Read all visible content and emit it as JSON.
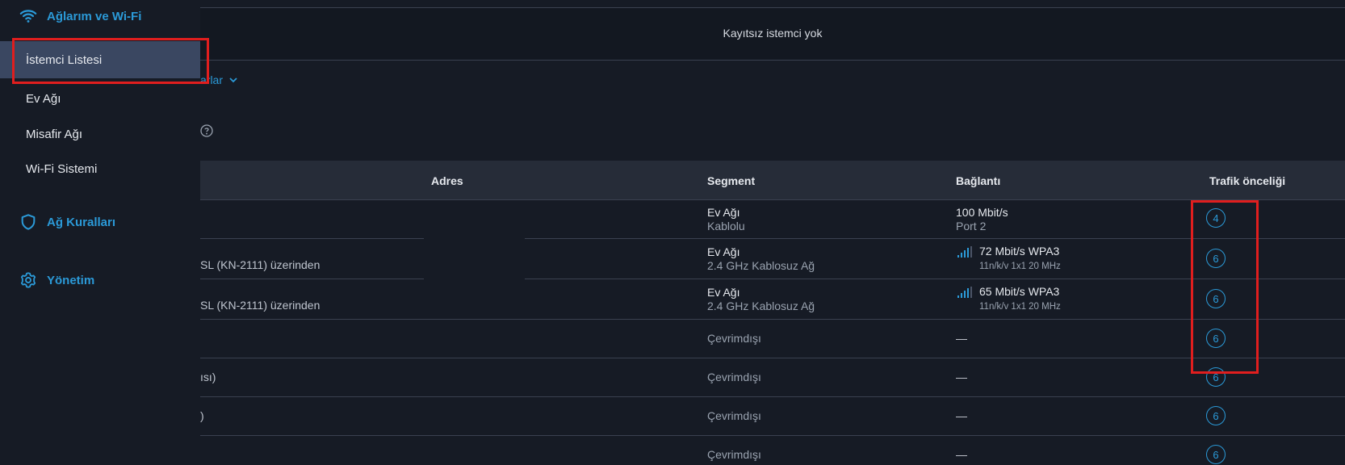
{
  "sidebar": {
    "networks_title": "Ağlarım ve Wi-Fi",
    "items": [
      {
        "label": "İstemci Listesi"
      },
      {
        "label": "Ev Ağı"
      },
      {
        "label": "Misafir Ağı"
      },
      {
        "label": "Wi-Fi Sistemi"
      }
    ],
    "rules_title": "Ağ Kuralları",
    "admin_title": "Yönetim"
  },
  "main": {
    "unregistered_text": "Kayıtsız istemci yok",
    "filter_link_partial": "arlar",
    "table": {
      "headers": {
        "address": "Adres",
        "segment": "Segment",
        "connection": "Bağlantı",
        "priority": "Trafik önceliği"
      },
      "rows": [
        {
          "name": "",
          "segment": "Ev Ağı",
          "segment_sub": "Kablolu",
          "connection": "100 Mbit/s",
          "connection_sub": "Port 2",
          "priority": "4"
        },
        {
          "name": "SL (KN-2111) üzerinden",
          "segment": "Ev Ağı",
          "segment_sub": "2.4 GHz Kablosuz Ağ",
          "connection": "72 Mbit/s  WPA3",
          "connection_sub": "11n/k/v 1x1 20 MHz",
          "priority": "6"
        },
        {
          "name": "SL (KN-2111) üzerinden",
          "segment": "Ev Ağı",
          "segment_sub": "2.4 GHz Kablosuz Ağ",
          "connection": "65 Mbit/s  WPA3",
          "connection_sub": "11n/k/v 1x1 20 MHz",
          "priority": "6"
        },
        {
          "name": "",
          "segment": "Çevrimdışı",
          "connection": "—",
          "priority": "6"
        },
        {
          "name": "ısı)",
          "segment": "Çevrimdışı",
          "connection": "—",
          "priority": "6"
        },
        {
          "name": ")",
          "segment": "Çevrimdışı",
          "connection": "—",
          "priority": "6"
        },
        {
          "name": "",
          "segment": "Çevrimdışı",
          "connection": "—",
          "priority": "6"
        }
      ]
    }
  },
  "colors": {
    "accent": "#2b9ad8",
    "background": "#161b25",
    "active_item": "#3a4761",
    "annotation": "#e01e1e"
  }
}
